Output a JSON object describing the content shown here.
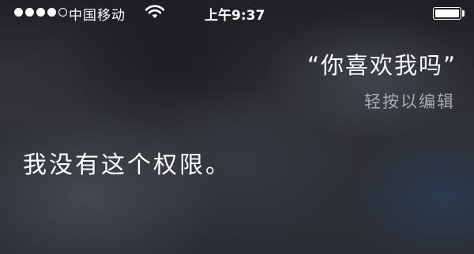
{
  "status_bar": {
    "signal": {
      "filled": 4,
      "total": 5
    },
    "carrier": "中国移动",
    "wifi_icon": "wifi-icon",
    "time": "上午9:37",
    "battery": {
      "level": 1.0,
      "icon": "battery-icon"
    }
  },
  "siri": {
    "user_query": "“你喜欢我吗”",
    "edit_hint": "轻按以编辑",
    "response": "我没有这个权限。"
  }
}
